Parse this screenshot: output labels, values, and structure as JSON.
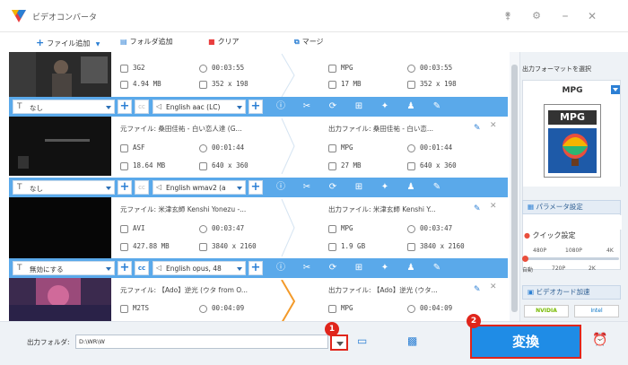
{
  "app": {
    "title": "ビデオコンバータ"
  },
  "toolbar": {
    "add_file": "ファイル追加",
    "add_folder": "フォルダ追加",
    "clear": "クリア",
    "merge": "マージ"
  },
  "items": [
    {
      "src_prefix": "",
      "src_name": "",
      "src_fmt": "3G2",
      "src_dur": "00:03:55",
      "src_size": "4.94 MB",
      "src_res": "352 x 198",
      "out_prefix": "",
      "out_name": "",
      "out_fmt": "MPG",
      "out_dur": "00:03:55",
      "out_size": "17 MB",
      "out_res": "352 x 198",
      "subtitle": "なし",
      "audio": "English aac (LC)"
    },
    {
      "src_prefix": "元ファイル:",
      "src_name": "桑田佳祐 - 白い恋人達 (G...",
      "src_fmt": "ASF",
      "src_dur": "00:01:44",
      "src_size": "18.64 MB",
      "src_res": "640 x 360",
      "out_prefix": "出力ファイル:",
      "out_name": "桑田佳祐 - 白い恋...",
      "out_fmt": "MPG",
      "out_dur": "00:01:44",
      "out_size": "27 MB",
      "out_res": "640 x 360",
      "subtitle": "なし",
      "audio": "English wmav2 (a"
    },
    {
      "src_prefix": "元ファイル:",
      "src_name": "米津玄師 Kenshi Yonezu -...",
      "src_fmt": "AVI",
      "src_dur": "00:03:47",
      "src_size": "427.88 MB",
      "src_res": "3840 x 2160",
      "out_prefix": "出力ファイル:",
      "out_name": "米津玄師 Kenshi Y...",
      "out_fmt": "MPG",
      "out_dur": "00:03:47",
      "out_size": "1.9 GB",
      "out_res": "3840 x 2160",
      "subtitle": "無効にする",
      "audio": "English opus, 48"
    },
    {
      "src_prefix": "元ファイル:",
      "src_name": "【Ado】逆光 (ウタ from O...",
      "src_fmt": "M2TS",
      "src_dur": "00:04:09",
      "src_size": "",
      "src_res": "",
      "out_prefix": "出力ファイル:",
      "out_name": "【Ado】逆光 (ウタ...",
      "out_fmt": "MPG",
      "out_dur": "00:04:09",
      "out_size": "",
      "out_res": ""
    }
  ],
  "right": {
    "label": "出力フォーマットを選択",
    "format": "MPG",
    "format_icon_text": "MPG",
    "param_btn": "パラメータ設定",
    "quick_label": "クイック設定",
    "quick_top": [
      "480P",
      "1080P",
      "4K"
    ],
    "quick_bottom": [
      "自動",
      "720P",
      "2K"
    ],
    "quick_value": 0,
    "gpu_label": "ビデオカード加速",
    "gpu_chips": [
      "NVIDIA",
      "Intel"
    ]
  },
  "bottom": {
    "label": "出力フォルダ:",
    "path": "D:\\WR\\W",
    "convert": "変換"
  },
  "badges": {
    "one": "1",
    "two": "2"
  },
  "colors": {
    "accent": "#2b7fd4",
    "strip": "#5aa9ea",
    "convert": "#1f8ce6",
    "badge": "#e0251b"
  }
}
